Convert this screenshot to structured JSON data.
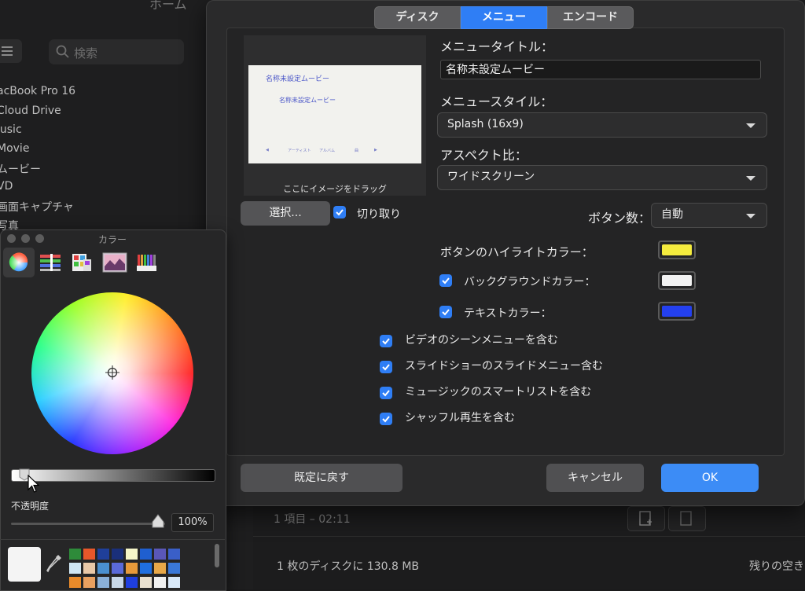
{
  "background": {
    "window_title": "ホーム",
    "search_placeholder": "検索",
    "sidebar_items": [
      "acBook Pro 16",
      "Cloud Drive",
      "lusic",
      "Movie",
      "ムービー",
      "VD",
      "画面キャプチャ",
      "写真"
    ],
    "items_count": "1 項目 – 02:11",
    "disk_info": "1 枚のディスクに 130.8 MB",
    "remaining": "残りの空き"
  },
  "dialog": {
    "tabs": [
      {
        "label": "ディスク",
        "selected": false
      },
      {
        "label": "メニュー",
        "selected": true
      },
      {
        "label": "エンコード",
        "selected": false
      }
    ],
    "preview": {
      "title": "名称未設定ムービー",
      "subtitle": "名称未設定ムービー",
      "nav_prev": "◀",
      "nav_artist": "アーティスト",
      "nav_album": "アルバム",
      "nav_song": "曲",
      "nav_next": "▶",
      "caption": "ここにイメージをドラッグ"
    },
    "select_button": "選択...",
    "crop_label": "切り取り",
    "crop_checked": true,
    "menu_title_label": "メニュータイトル：",
    "menu_title_value": "名称未設定ムービー",
    "menu_style_label": "メニュースタイル：",
    "menu_style_value": "Splash (16x9)",
    "aspect_label": "アスペクト比：",
    "aspect_value": "ワイドスクリーン",
    "button_count_label": "ボタン数：",
    "button_count_value": "自動",
    "highlight_color_label": "ボタンのハイライトカラー：",
    "highlight_color": "#f5ec3e",
    "background_color_label": "バックグラウンドカラー：",
    "background_color": "#f2f2f2",
    "background_color_checked": true,
    "text_color_label": "テキストカラー：",
    "text_color": "#2440f0",
    "text_color_checked": true,
    "options": [
      {
        "label": "ビデオのシーンメニューを含む",
        "checked": true
      },
      {
        "label": "スライドショーのスライドメニュー含む",
        "checked": true
      },
      {
        "label": "ミュージックのスマートリストを含む",
        "checked": true
      },
      {
        "label": "シャッフル再生を含む",
        "checked": true
      }
    ],
    "reset_button": "既定に戻す",
    "cancel_button": "キャンセル",
    "ok_button": "OK",
    "accent_color": "#2f7ef5"
  },
  "color_panel": {
    "title": "カラー",
    "toolbar_icons": [
      "color-wheel-icon",
      "color-sliders-icon",
      "color-palettes-icon",
      "image-palettes-icon",
      "pencils-icon"
    ],
    "selected_tool": "color-wheel-icon",
    "opacity_label": "不透明度",
    "opacity_value": "100%",
    "brightness_level": 0.05,
    "current_color": "#f4f4f4",
    "swatches": [
      "#2e8b3a",
      "#e8572a",
      "#1f3f9a",
      "#1a2f7a",
      "#f6f6c8",
      "#1f5fd0",
      "#5a57b8",
      "#3a5fc8",
      "#cfe6f4",
      "#e8c8a8",
      "#4a90d0",
      "#5a6ad8",
      "#e89a3a",
      "#1f6fe0",
      "#e8a848",
      "#3a78d8",
      "#e88a2a",
      "#e8a060",
      "#8ab0d8",
      "#c8d8e8",
      "#1f3fe0",
      "#e8e0d0",
      "#f0f0f0",
      "#d8e8f8"
    ]
  }
}
